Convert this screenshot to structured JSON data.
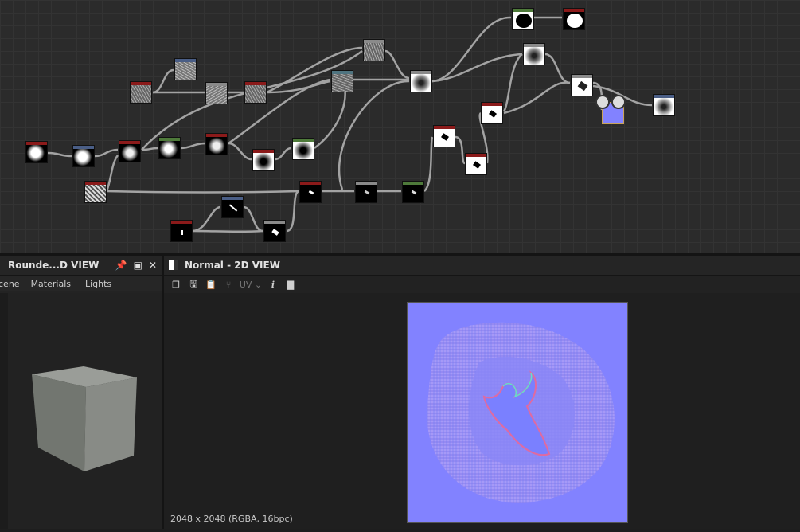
{
  "left_panel": {
    "title": "Rounde...D VIEW",
    "tabs": [
      "cene",
      "Materials",
      "Lights"
    ]
  },
  "right_panel": {
    "title": "Normal - 2D VIEW",
    "uv_label": "UV",
    "info_icon": "i",
    "status": "2048 x 2048 (RGBA, 16bpc)"
  },
  "colors": {
    "node_red": "#8b1a1a",
    "node_blue": "#4a5e86",
    "node_green": "#4e7a3a",
    "node_gray": "#8a8a8a",
    "node_teal": "#4f7480",
    "normal_map": "#8282ff"
  },
  "icons": [
    "pin-icon",
    "maximize-icon",
    "close-icon",
    "copy-view-icon",
    "save-icon",
    "paste-icon",
    "share-icon",
    "info-icon",
    "histogram-icon",
    "checker-icon"
  ]
}
